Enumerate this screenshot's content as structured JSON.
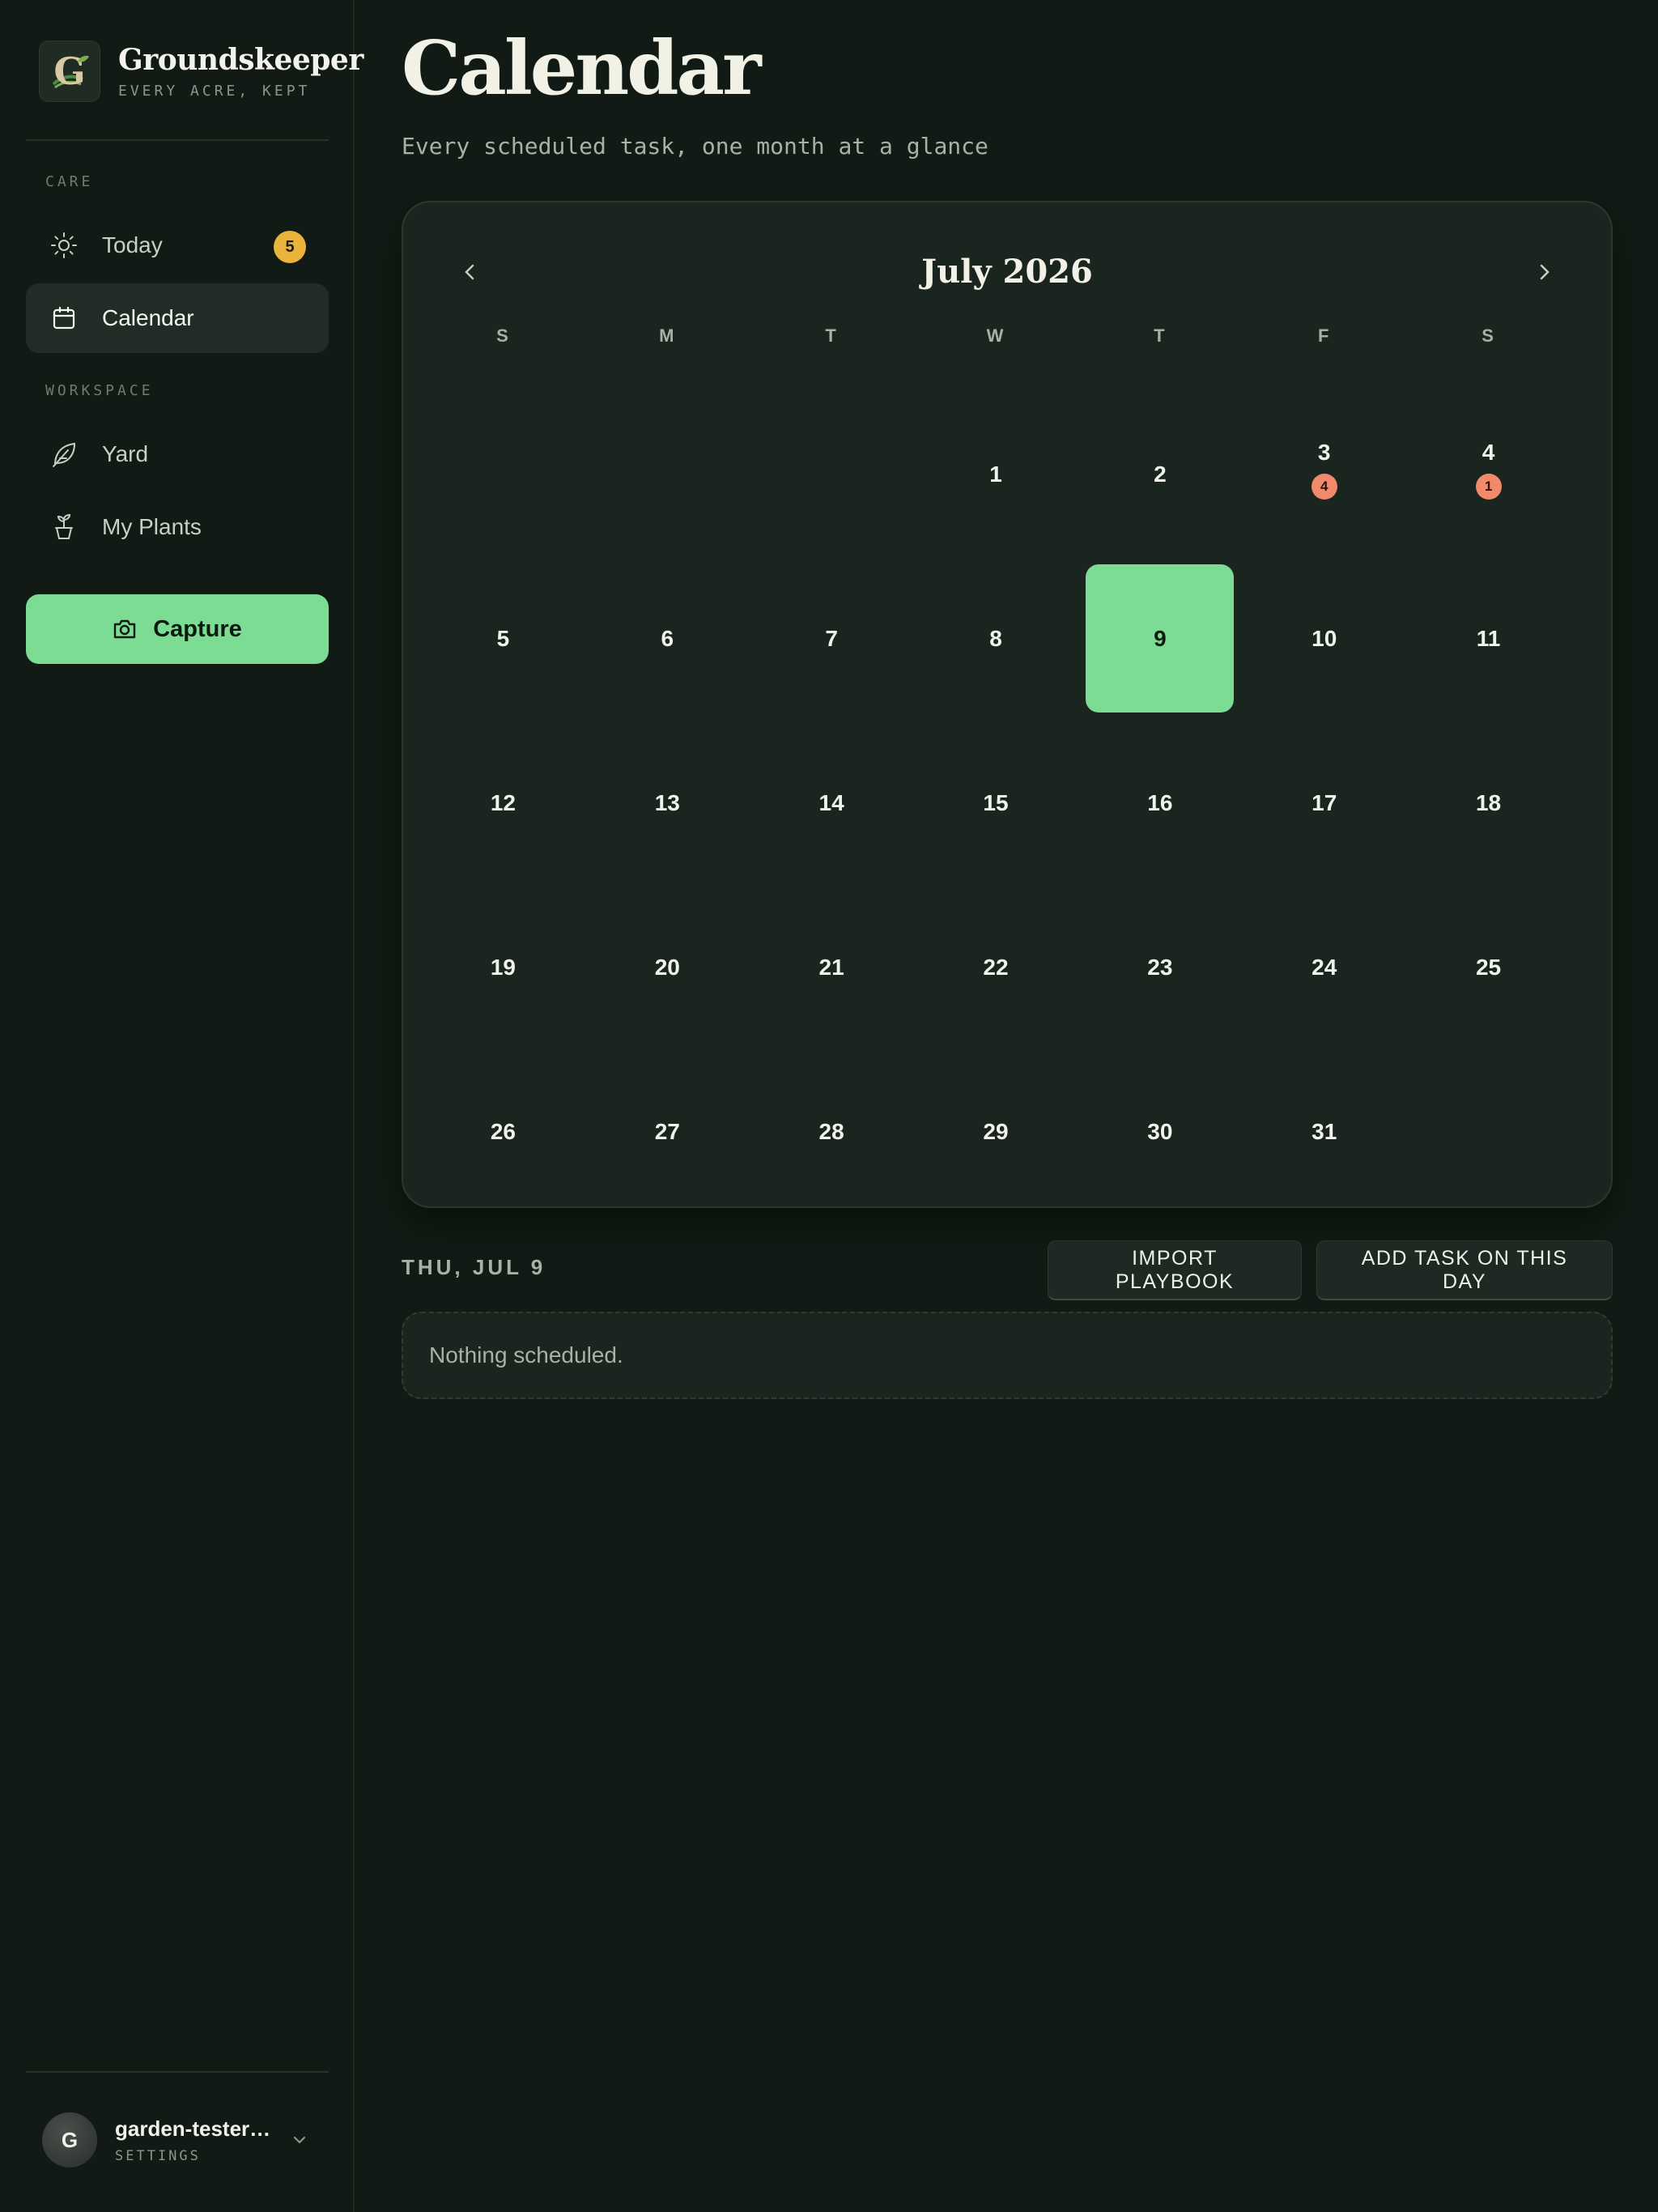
{
  "brand": {
    "title": "Groundskeeper",
    "tagline": "EVERY ACRE, KEPT",
    "logo_letter": "G"
  },
  "sidebar": {
    "sections": [
      {
        "label": "CARE"
      },
      {
        "label": "WORKSPACE"
      }
    ],
    "items": [
      {
        "label": "Today",
        "icon": "sun-icon",
        "badge": "5"
      },
      {
        "label": "Calendar",
        "icon": "calendar-icon",
        "active": true
      },
      {
        "label": "Yard",
        "icon": "leaf-icon"
      },
      {
        "label": "My Plants",
        "icon": "potted-plant-icon"
      }
    ],
    "capture_label": "Capture"
  },
  "user": {
    "initial": "G",
    "name": "garden-tester…",
    "sub": "SETTINGS"
  },
  "page": {
    "title": "Calendar",
    "subtitle": "Every scheduled task, one month at a glance"
  },
  "calendar": {
    "month_label": "July 2026",
    "weekdays": [
      "S",
      "M",
      "T",
      "W",
      "T",
      "F",
      "S"
    ],
    "first_weekday_index": 3,
    "days_in_month": 31,
    "selected_day": 9,
    "task_counts": {
      "3": "4",
      "4": "1"
    }
  },
  "selection": {
    "date_label": "THU, JUL 9",
    "import_label": "IMPORT PLAYBOOK",
    "add_label": "ADD TASK ON THIS DAY",
    "empty_text": "Nothing scheduled."
  },
  "colors": {
    "accent": "#7ddc94",
    "badge": "#e9b33c",
    "task_dot": "#f08a6b",
    "background": "#111a14"
  }
}
